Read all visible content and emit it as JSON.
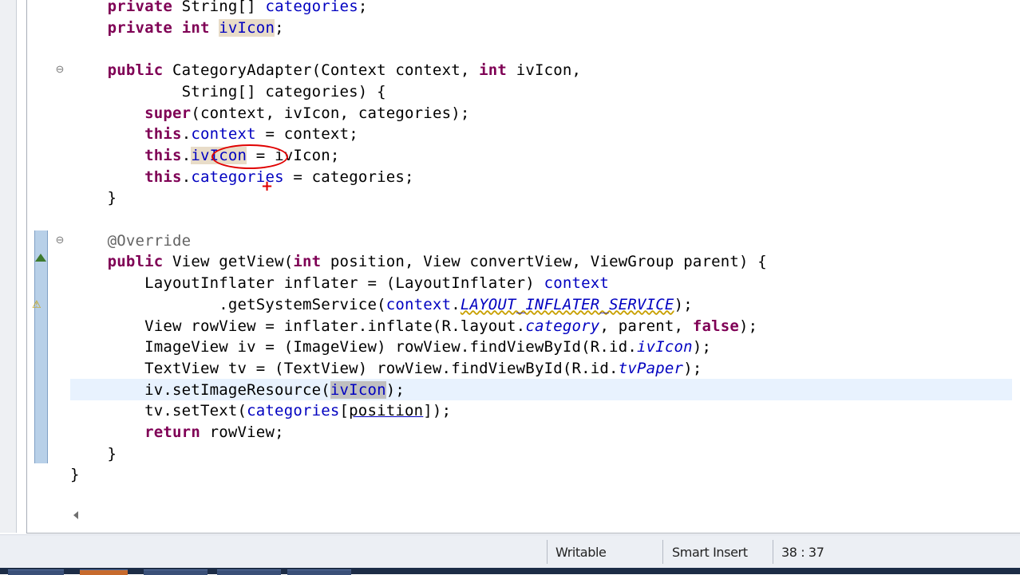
{
  "editor": {
    "lines": [
      [
        {
          "t": "    "
        },
        {
          "t": "private",
          "c": "kw"
        },
        {
          "t": " String[] "
        },
        {
          "t": "categories",
          "c": "fld"
        },
        {
          "t": ";"
        }
      ],
      [
        {
          "t": "    "
        },
        {
          "t": "private",
          "c": "kw"
        },
        {
          "t": " "
        },
        {
          "t": "int",
          "c": "kw"
        },
        {
          "t": " "
        },
        {
          "t": "ivIcon",
          "c": "fld occ"
        },
        {
          "t": ";"
        }
      ],
      [],
      [
        {
          "t": "    "
        },
        {
          "t": "public",
          "c": "kw"
        },
        {
          "t": " CategoryAdapter(Context context, "
        },
        {
          "t": "int",
          "c": "kw"
        },
        {
          "t": " ivIcon,"
        }
      ],
      [
        {
          "t": "            String[] categories) {"
        }
      ],
      [
        {
          "t": "        "
        },
        {
          "t": "super",
          "c": "kw"
        },
        {
          "t": "(context, ivIcon, categories);"
        }
      ],
      [
        {
          "t": "        "
        },
        {
          "t": "this",
          "c": "kw"
        },
        {
          "t": "."
        },
        {
          "t": "context",
          "c": "fld"
        },
        {
          "t": " = context;"
        }
      ],
      [
        {
          "t": "        "
        },
        {
          "t": "this",
          "c": "kw"
        },
        {
          "t": "."
        },
        {
          "t": "ivIcon",
          "c": "fld occ"
        },
        {
          "t": " = ivIcon;"
        }
      ],
      [
        {
          "t": "        "
        },
        {
          "t": "this",
          "c": "kw"
        },
        {
          "t": "."
        },
        {
          "t": "categories",
          "c": "fld"
        },
        {
          "t": " = categories;"
        }
      ],
      [
        {
          "t": "    }"
        }
      ],
      [],
      [
        {
          "t": "    "
        },
        {
          "t": "@Override",
          "c": "ann"
        }
      ],
      [
        {
          "t": "    "
        },
        {
          "t": "public",
          "c": "kw"
        },
        {
          "t": " View getView("
        },
        {
          "t": "int",
          "c": "kw"
        },
        {
          "t": " position, View convertView, ViewGroup parent) {"
        }
      ],
      [
        {
          "t": "        LayoutInflater inflater = (LayoutInflater) "
        },
        {
          "t": "context",
          "c": "fld"
        }
      ],
      [
        {
          "t": "                .getSystemService("
        },
        {
          "t": "context",
          "c": "fld"
        },
        {
          "t": "."
        },
        {
          "t": "LAYOUT_INFLATER_SERVICE",
          "c": "sfld warn-u"
        },
        {
          "t": ");"
        }
      ],
      [
        {
          "t": "        View rowView = inflater.inflate(R.layout."
        },
        {
          "t": "category",
          "c": "sfld"
        },
        {
          "t": ", parent, "
        },
        {
          "t": "false",
          "c": "kw"
        },
        {
          "t": ");"
        }
      ],
      [
        {
          "t": "        ImageView iv = (ImageView) rowView.findViewById(R.id."
        },
        {
          "t": "ivIcon",
          "c": "sfld"
        },
        {
          "t": ");"
        }
      ],
      [
        {
          "t": "        TextView tv = (TextView) rowView.findViewById(R.id."
        },
        {
          "t": "tvPaper",
          "c": "sfld"
        },
        {
          "t": ");"
        }
      ],
      [
        {
          "t": "        iv.setImageResource("
        },
        {
          "t": "ivIcon",
          "c": "fld occ-sel"
        },
        {
          "t": ");"
        }
      ],
      [
        {
          "t": "        tv.setText("
        },
        {
          "t": "categories",
          "c": "fld"
        },
        {
          "t": "["
        },
        {
          "t": "position",
          "c": "link-u"
        },
        {
          "t": "]);"
        }
      ],
      [
        {
          "t": "        "
        },
        {
          "t": "return",
          "c": "kw"
        },
        {
          "t": " rowView;"
        }
      ],
      [
        {
          "t": "    }"
        }
      ],
      [
        {
          "t": "}"
        }
      ]
    ],
    "current_line_index": 18,
    "annotation_color": "#e00000"
  },
  "colors": {
    "keyword": "#7f0055",
    "field": "#0000c0",
    "annotation": "#646464",
    "occurrence_highlight": "#e8dcc8",
    "current_line": "#e8f2fe"
  },
  "status": {
    "mode": "Writable",
    "insert": "Smart Insert",
    "position": "38 : 37"
  }
}
